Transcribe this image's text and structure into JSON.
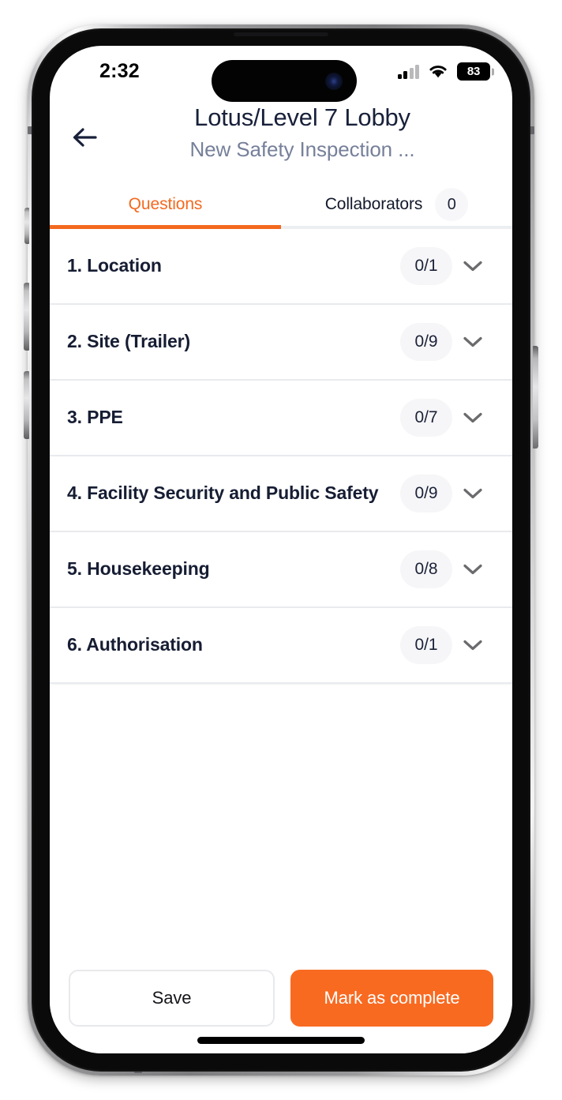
{
  "status_bar": {
    "time": "2:32",
    "cellular_icon": "cellular-bars-icon",
    "wifi_icon": "wifi-icon",
    "battery_icon": "battery-icon",
    "battery_level": "83"
  },
  "header": {
    "back_icon": "arrow-left-icon",
    "title": "Lotus/Level 7 Lobby",
    "subtitle": "New Safety Inspection ..."
  },
  "tabs": [
    {
      "label": "Questions",
      "active": true,
      "badge": null
    },
    {
      "label": "Collaborators",
      "active": false,
      "badge": "0"
    }
  ],
  "questions": [
    {
      "title": "1. Location",
      "count": "0/1",
      "chevron": "chevron-down-icon"
    },
    {
      "title": "2. Site (Trailer)",
      "count": "0/9",
      "chevron": "chevron-down-icon"
    },
    {
      "title": "3. PPE",
      "count": "0/7",
      "chevron": "chevron-down-icon"
    },
    {
      "title": "4. Facility Security and Public Safety",
      "count": "0/9",
      "chevron": "chevron-down-icon"
    },
    {
      "title": "5. Housekeeping",
      "count": "0/8",
      "chevron": "chevron-down-icon"
    },
    {
      "title": "6. Authorisation",
      "count": "0/1",
      "chevron": "chevron-down-icon"
    }
  ],
  "footer": {
    "save_label": "Save",
    "complete_label": "Mark as complete"
  },
  "colors": {
    "accent_orange": "#f96a21",
    "title_navy": "#18203a",
    "subtitle_gray": "#76809a",
    "pill_bg": "#f6f6f8",
    "divider": "#e9eaee"
  }
}
